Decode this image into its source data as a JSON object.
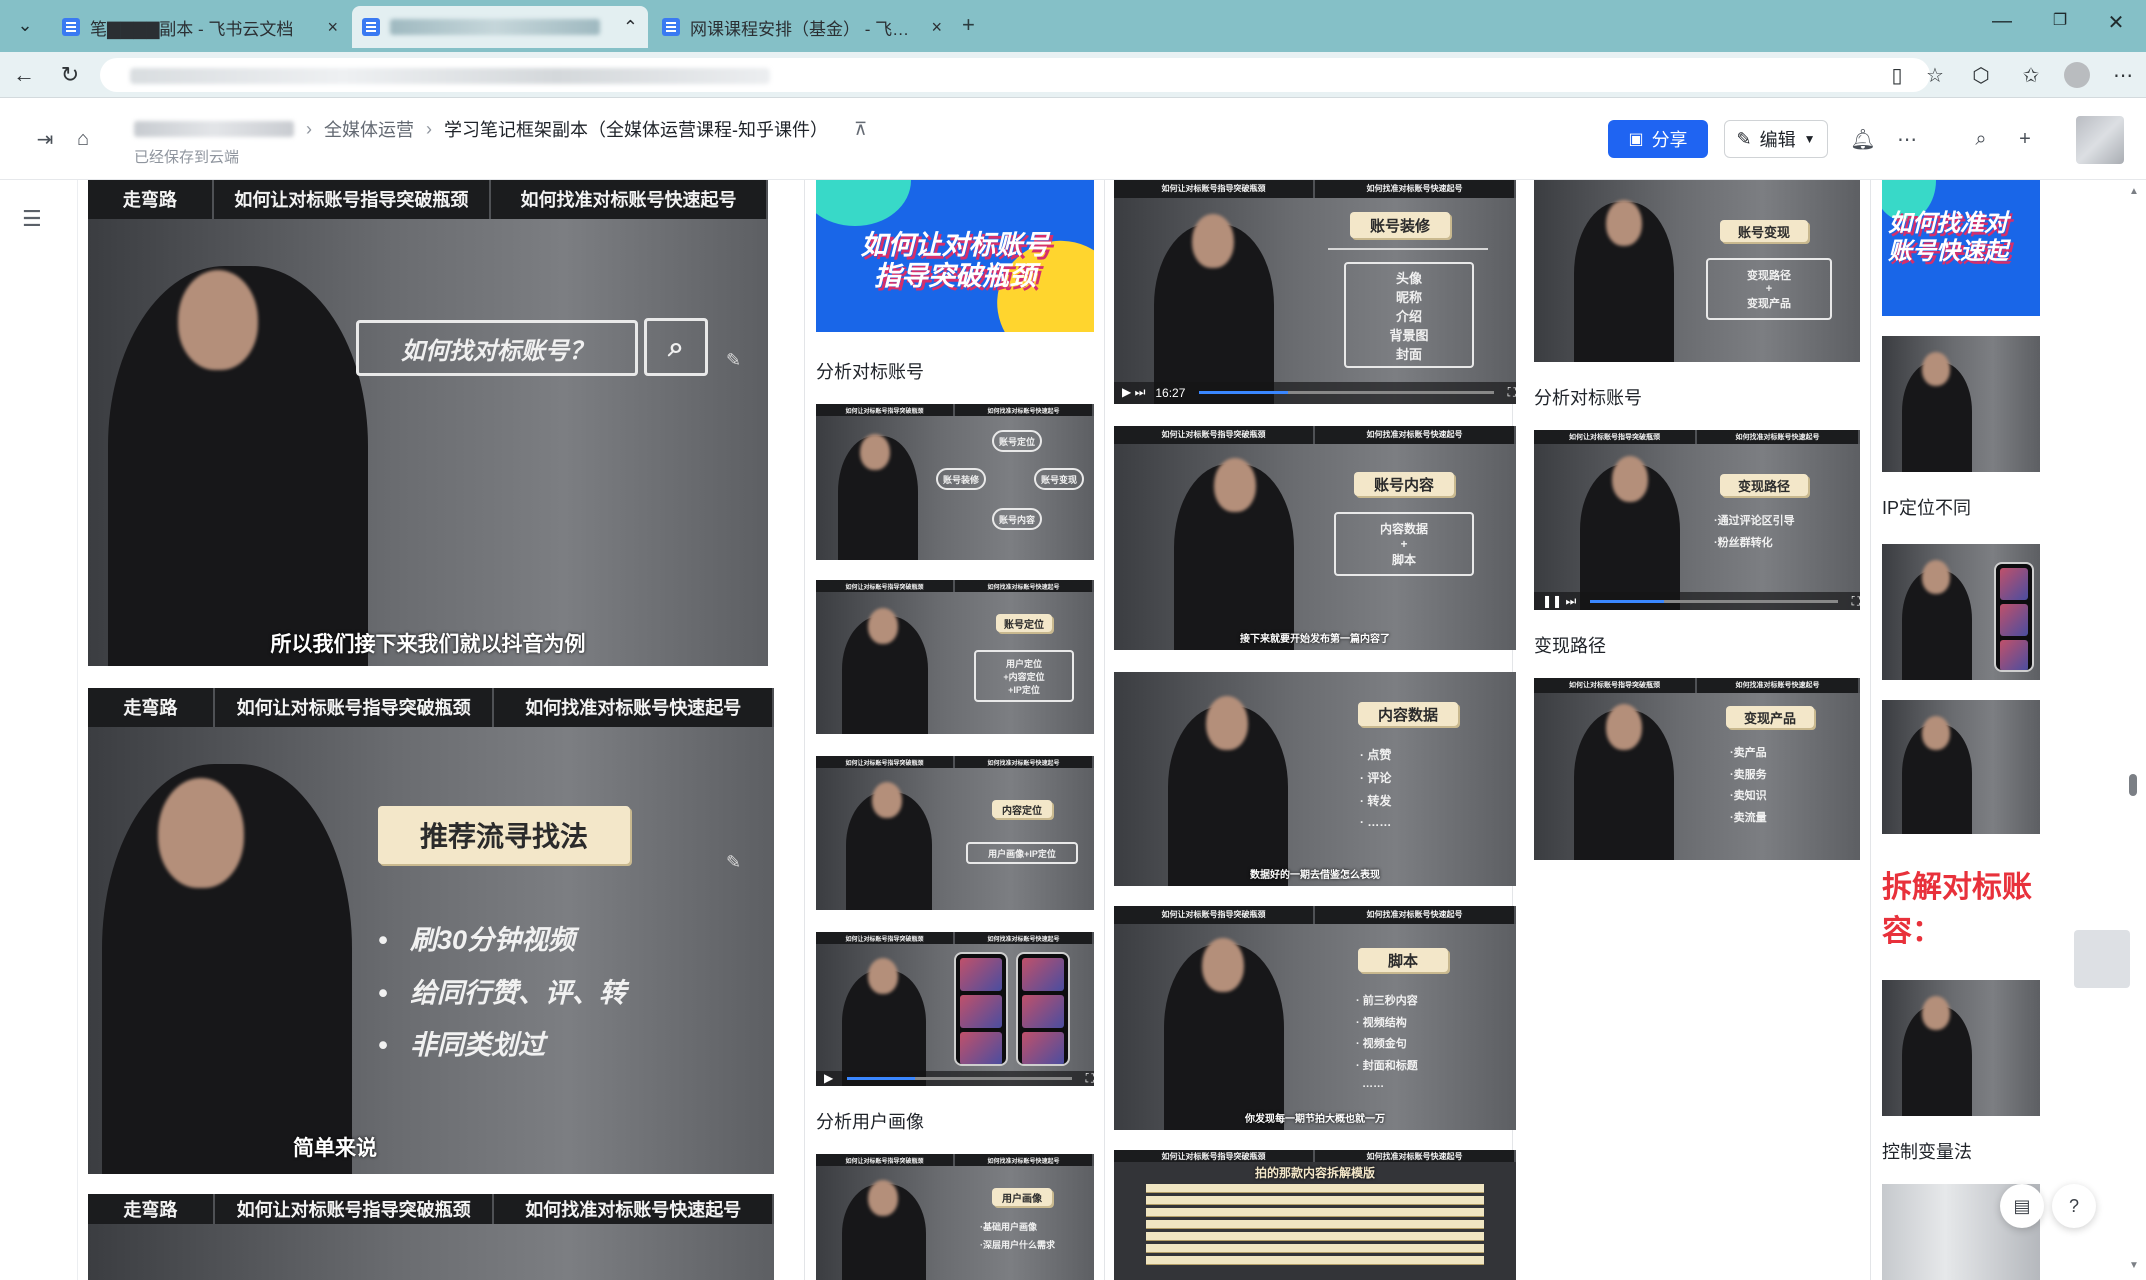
{
  "browser": {
    "tabs": [
      {
        "title": "笔▇▇▇▇副本 - 飞书云文档",
        "active": false
      },
      {
        "title": "",
        "active": true
      },
      {
        "title": "网课课程安排（基金） - 飞书云文",
        "active": false
      }
    ],
    "icons": {
      "tab_list": "chevron-down-icon",
      "back": "back-arrow-icon",
      "reload": "reload-icon",
      "new_tab": "plus-icon",
      "minimize": "minimize-icon",
      "restore": "restore-icon",
      "close": "close-icon"
    }
  },
  "doc": {
    "breadcrumb": {
      "level2": "全媒体运营",
      "current": "学习笔记框架副本（全媒体运营课程-知乎课件）"
    },
    "saved_status": "已经保存到云端",
    "share_label": "分享",
    "edit_label": "编辑",
    "colors": {
      "accent": "#1f64f2",
      "red_heading": "#e8313b"
    }
  },
  "slides": {
    "topbar": [
      "走弯路",
      "如何让对标账号指导突破瓶颈",
      "如何找准对标账号快速起号"
    ],
    "big1": {
      "board": "如何找对标账号？",
      "subtitle": "所以我们接下来我们就以抖音为例"
    },
    "big2": {
      "title": "推荐流寻找法",
      "bullets": [
        "刷30分钟视频",
        "给同行赞、评、转",
        "非同类划过"
      ],
      "subtitle": "简单来说"
    },
    "cover1": "如何让对标账号\n指导突破瓶颈",
    "cover2": "如何找准对\n账号快速起",
    "c2a": {
      "title": "账号装修",
      "bullets": [
        "头像",
        "昵称",
        "介绍",
        "背景图",
        "封面"
      ],
      "time": "16:27"
    },
    "c2b": {
      "title": "账号内容",
      "bullets": [
        "内容数据",
        "+",
        "脚本"
      ],
      "subtitle": "接下来就要开始发布第一篇内容了"
    },
    "c2c": {
      "title": "内容数据",
      "bullets": [
        "点赞",
        "评论",
        "转发",
        "……"
      ],
      "subtitle": "数据好的一期去借鉴怎么表现"
    },
    "c2d": {
      "title": "脚本",
      "bullets": [
        "前三秒内容",
        "视频结构",
        "视频金句",
        "封面和标题",
        "……"
      ],
      "subtitle": "你发现每一期节拍大概也就一万"
    },
    "c2e": {
      "title": "拍的那款内容拆解模版"
    },
    "c1b": {
      "labels": [
        "账号定位",
        "账号装修",
        "账号内容",
        "账号变现"
      ]
    },
    "c1c": {
      "title": "账号定位",
      "bullets": [
        "用户定位",
        "+内容定位",
        "+IP定位"
      ]
    },
    "c1d": {
      "title": "内容定位",
      "bullets": [
        "用户画像+IP定位"
      ]
    },
    "c1f": {
      "title": "用户画像",
      "bullets": [
        "·基础用户画像",
        "·深层用户什么需求"
      ]
    },
    "c3a": {
      "title": "账号变现",
      "bullets": [
        "变现路径",
        "+",
        "变现产品"
      ]
    },
    "c3b": {
      "title": "变现路径",
      "bullets": [
        "·通过评论区引导",
        "·粉丝群转化"
      ]
    },
    "c3c": {
      "title": "变现产品",
      "bullets": [
        "·卖产品",
        "·卖服务",
        "·卖知识",
        "·卖流量"
      ]
    }
  },
  "captions": {
    "c1_analyze": "分析对标账号",
    "c1_user": "分析用户画像",
    "c3_analyze": "分析对标账号",
    "c3_path": "变现路径",
    "c4_ip": "IP定位不同",
    "c4_heading": "拆解对标账\n容：",
    "c4_control": "控制变量法"
  }
}
